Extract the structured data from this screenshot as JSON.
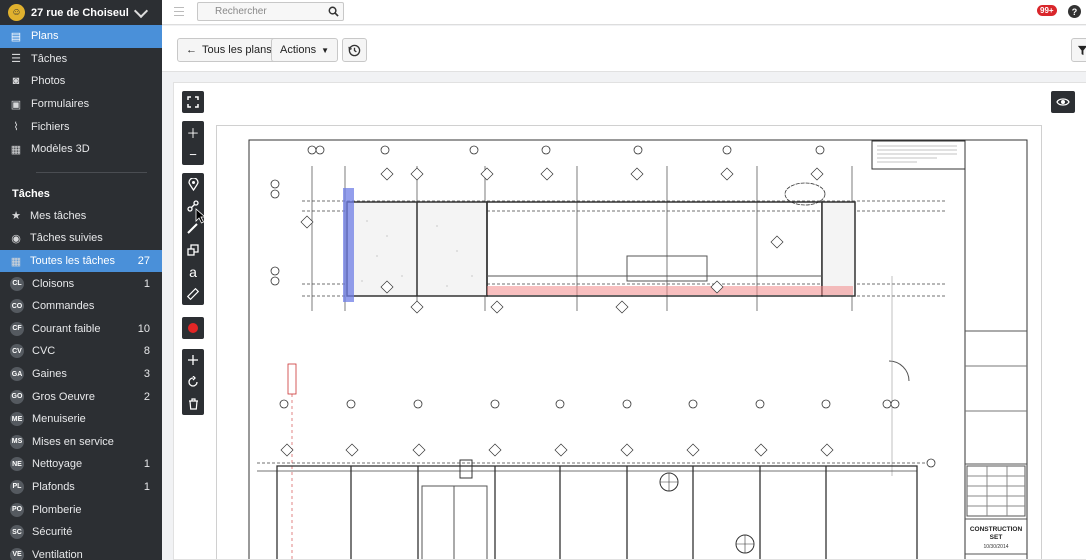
{
  "project": {
    "name": "27 rue de Choiseul"
  },
  "nav": [
    {
      "label": "Plans",
      "icon": "map-icon",
      "active": true
    },
    {
      "label": "Tâches",
      "icon": "list-icon"
    },
    {
      "label": "Photos",
      "icon": "camera-icon"
    },
    {
      "label": "Formulaires",
      "icon": "clipboard-icon"
    },
    {
      "label": "Fichiers",
      "icon": "paperclip-icon"
    },
    {
      "label": "Modèles 3D",
      "icon": "cube-icon"
    }
  ],
  "tasks_section": {
    "title": "Tâches",
    "items": [
      {
        "label": "Mes tâches",
        "icon": "star-icon"
      },
      {
        "label": "Tâches suivies",
        "icon": "eye-icon"
      },
      {
        "label": "Toutes les tâches",
        "icon": "grid-icon",
        "count": "27",
        "active": true
      }
    ],
    "categories": [
      {
        "abbr": "CL",
        "label": "Cloisons",
        "count": "1"
      },
      {
        "abbr": "CO",
        "label": "Commandes",
        "count": ""
      },
      {
        "abbr": "CF",
        "label": "Courant faible",
        "count": "10"
      },
      {
        "abbr": "CV",
        "label": "CVC",
        "count": "8"
      },
      {
        "abbr": "GA",
        "label": "Gaines",
        "count": "3"
      },
      {
        "abbr": "GO",
        "label": "Gros Oeuvre",
        "count": "2"
      },
      {
        "abbr": "ME",
        "label": "Menuiserie",
        "count": ""
      },
      {
        "abbr": "MS",
        "label": "Mises en service",
        "count": ""
      },
      {
        "abbr": "NE",
        "label": "Nettoyage",
        "count": "1"
      },
      {
        "abbr": "PL",
        "label": "Plafonds",
        "count": "1"
      },
      {
        "abbr": "PO",
        "label": "Plomberie",
        "count": ""
      },
      {
        "abbr": "SC",
        "label": "Sécurité",
        "count": ""
      },
      {
        "abbr": "VE",
        "label": "Ventilation",
        "count": ""
      }
    ]
  },
  "search": {
    "placeholder": "Rechercher"
  },
  "notifications": {
    "count": "99+"
  },
  "help": {
    "label": "?"
  },
  "toolbar": {
    "all_plans": "Tous les plans",
    "actions": "Actions"
  },
  "plan": {
    "title_block": "CONSTRUCTION SET",
    "date": "10/30/2014"
  },
  "colors": {
    "accent": "#4a90d9",
    "sidebar": "#2c2f33",
    "alert": "#d9262b"
  }
}
